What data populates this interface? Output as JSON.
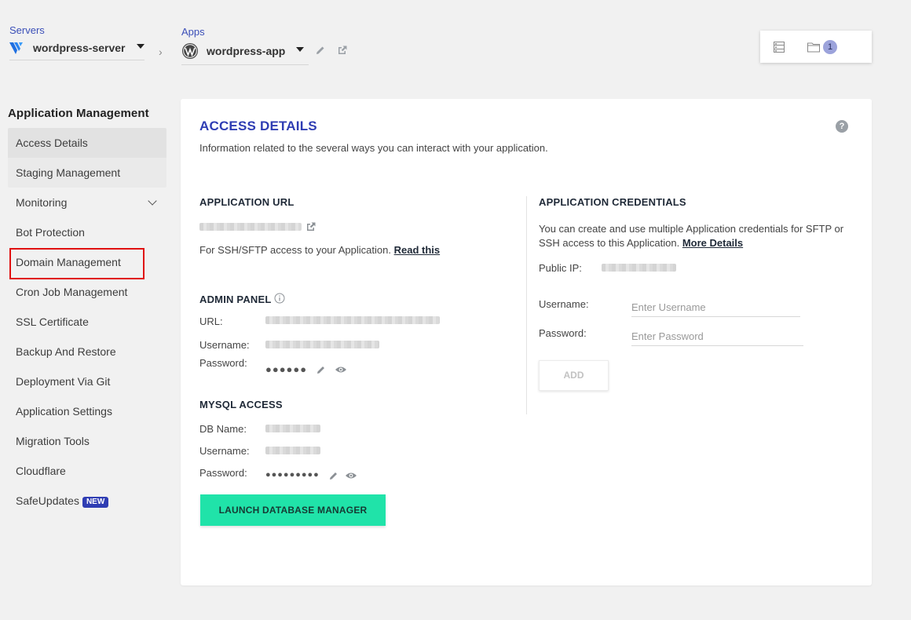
{
  "topbar": {
    "servers_label": "Servers",
    "server_name": "wordpress-server",
    "apps_label": "Apps",
    "app_name": "wordpress-app",
    "notification_count": "1"
  },
  "sidebar": {
    "title": "Application Management",
    "items": [
      {
        "label": "Access Details"
      },
      {
        "label": "Staging Management"
      },
      {
        "label": "Monitoring"
      },
      {
        "label": "Bot Protection"
      },
      {
        "label": "Domain Management"
      },
      {
        "label": "Cron Job Management"
      },
      {
        "label": "SSL Certificate"
      },
      {
        "label": "Backup And Restore"
      },
      {
        "label": "Deployment Via Git"
      },
      {
        "label": "Application Settings"
      },
      {
        "label": "Migration Tools"
      },
      {
        "label": "Cloudflare"
      },
      {
        "label": "SafeUpdates",
        "badge": "NEW"
      }
    ]
  },
  "main": {
    "title": "ACCESS DETAILS",
    "subtitle": "Information related to the several ways you can interact with your application.",
    "app_url": {
      "heading": "APPLICATION URL",
      "ssh_note": "For SSH/SFTP access to your Application.",
      "read_this": "Read this"
    },
    "admin_panel": {
      "heading": "ADMIN PANEL",
      "url_label": "URL:",
      "username_label": "Username:",
      "password_label": "Password:",
      "password_mask": "●●●●●●"
    },
    "mysql": {
      "heading": "MYSQL ACCESS",
      "db_label": "DB Name:",
      "username_label": "Username:",
      "password_label": "Password:",
      "password_mask": "●●●●●●●●●",
      "launch_button": "LAUNCH DATABASE MANAGER"
    },
    "credentials": {
      "heading": "APPLICATION CREDENTIALS",
      "description": "You can create and use multiple Application credentials for SFTP or SSH access to this Application.",
      "more_details": "More Details",
      "public_ip_label": "Public IP:",
      "username_label": "Username:",
      "username_placeholder": "Enter Username",
      "password_label": "Password:",
      "password_placeholder": "Enter Password",
      "add_button": "ADD"
    }
  },
  "colors": {
    "accent": "#2f3db3",
    "launch_button": "#20e3a9",
    "highlight_box": "#e01010"
  }
}
